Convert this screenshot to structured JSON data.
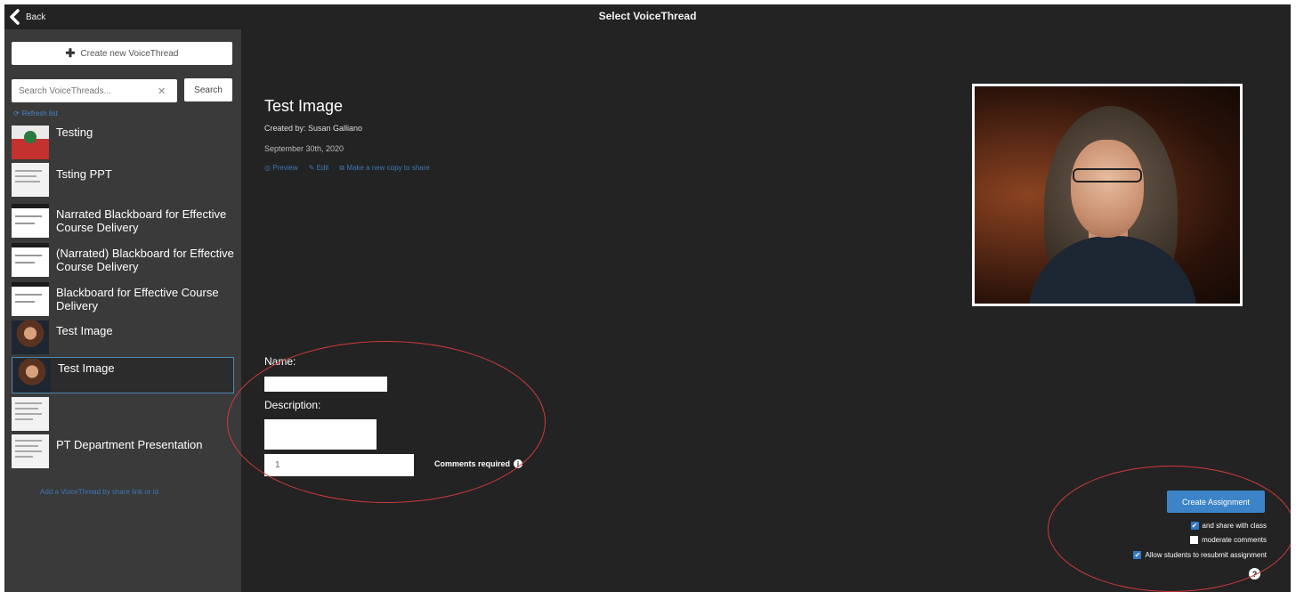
{
  "header": {
    "back_label": "Back",
    "title": "Select VoiceThread"
  },
  "sidebar": {
    "create_label": "Create new VoiceThread",
    "search_placeholder": "Search VoiceThreads...",
    "search_button": "Search",
    "refresh_label": "Refresh list",
    "items": [
      {
        "label": "Testing",
        "thumb": "testing"
      },
      {
        "label": "Tsting PPT",
        "thumb": "doc"
      },
      {
        "label": "Narrated Blackboard for Effective Course Delivery",
        "thumb": "slide"
      },
      {
        "label": "(Narrated) Blackboard for Effective Course Delivery",
        "thumb": "slide"
      },
      {
        "label": "Blackboard for Effective Course Delivery",
        "thumb": "slide"
      },
      {
        "label": "Test Image",
        "thumb": "photo"
      },
      {
        "label": "Test Image",
        "thumb": "photo",
        "selected": true
      },
      {
        "label": "",
        "thumb": "doc"
      },
      {
        "label": "PT Department Presentation",
        "thumb": "doc"
      }
    ],
    "add_link": "Add a VoiceThread by share link or id"
  },
  "main": {
    "title": "Test Image",
    "created_by": "Created by: Susan Galliano",
    "date": "September 30th, 2020",
    "actions": [
      "Preview",
      "Edit",
      "Make a new copy to share"
    ],
    "name_label": "Name:",
    "description_label": "Description:",
    "comments_value": "1",
    "comments_label": "Comments required",
    "create_button": "Create Assignment",
    "options": [
      {
        "label": "and share with class",
        "checked": true
      },
      {
        "label": "moderate comments",
        "checked": false
      },
      {
        "label": "Allow students to resubmit assignment",
        "checked": true
      }
    ]
  },
  "colors": {
    "background": "#232323",
    "sidebar": "#3a3a3a",
    "accent": "#3c84c7",
    "annotation": "#d23a3a"
  }
}
